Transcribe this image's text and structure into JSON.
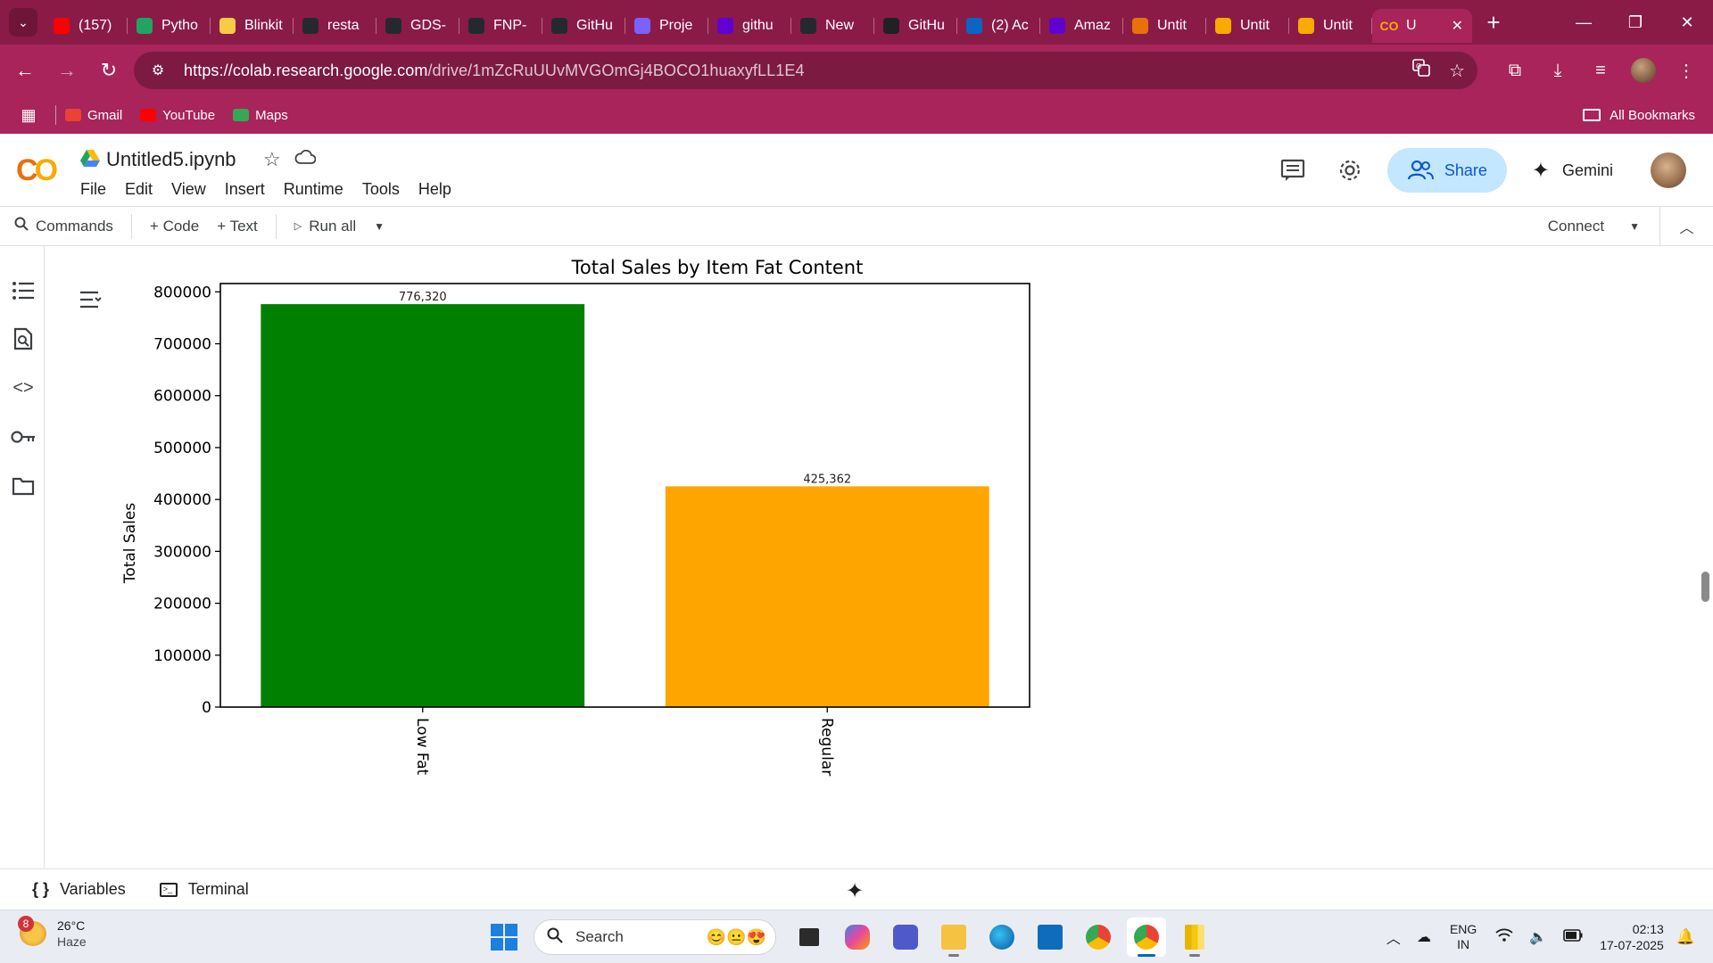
{
  "browser": {
    "tabs": [
      {
        "title": "(157)",
        "icon": "youtube-icon",
        "color": "#ff0000"
      },
      {
        "title": "Pytho",
        "icon": "google-drive-icon",
        "color": "#1fa463"
      },
      {
        "title": "Blinkit",
        "icon": "blinkit-icon",
        "color": "#f8cb46"
      },
      {
        "title": "resta",
        "icon": "github-icon",
        "color": "#24292f"
      },
      {
        "title": "GDS-",
        "icon": "github-icon",
        "color": "#24292f"
      },
      {
        "title": "FNP-",
        "icon": "github-icon",
        "color": "#24292f"
      },
      {
        "title": "GitHu",
        "icon": "github-icon",
        "color": "#24292f"
      },
      {
        "title": "Proje",
        "icon": "docs-icon",
        "color": "#7b61ff"
      },
      {
        "title": "githu",
        "icon": "yahoo-icon",
        "color": "#6001d2"
      },
      {
        "title": "New",
        "icon": "github-icon",
        "color": "#24292f"
      },
      {
        "title": "GitHu",
        "icon": "chatgpt-icon",
        "color": "#202123"
      },
      {
        "title": "(2) Ac",
        "icon": "linkedin-icon",
        "color": "#0a66c2"
      },
      {
        "title": "Amaz",
        "icon": "yahoo-icon",
        "color": "#6001d2"
      },
      {
        "title": "Untit",
        "icon": "colab-icon",
        "color": "#e8710a"
      },
      {
        "title": "Untit",
        "icon": "colab-icon",
        "color": "#f9ab00"
      },
      {
        "title": "Untit",
        "icon": "colab-icon",
        "color": "#f9ab00"
      }
    ],
    "active_tab": {
      "title": "U",
      "icon": "colab-icon"
    },
    "url_host": "https://colab.research.google.com",
    "url_path": "/drive/1mZcRuUUvMVGOmGj4BOCO1huaxyfLL1E4",
    "bookmarks": [
      {
        "label": "Gmail",
        "color": "#ea4335"
      },
      {
        "label": "YouTube",
        "color": "#ff0000"
      },
      {
        "label": "Maps",
        "color": "#34a853"
      }
    ],
    "all_bookmarks": "All Bookmarks",
    "accent": "#a8245a"
  },
  "colab": {
    "notebook_title": "Untitled5.ipynb",
    "menu": [
      "File",
      "Edit",
      "View",
      "Insert",
      "Runtime",
      "Tools",
      "Help"
    ],
    "share_label": "Share",
    "gemini_label": "Gemini",
    "toolbar": {
      "commands": "Commands",
      "code": "+ Code",
      "text": "+ Text",
      "run_all": "Run all",
      "connect": "Connect"
    },
    "status": {
      "variables": "Variables",
      "terminal": "Terminal"
    }
  },
  "chart_data": {
    "type": "bar",
    "title": "Total Sales by Item Fat Content",
    "xlabel": "",
    "ylabel": "Total Sales",
    "categories": [
      "Low Fat",
      "Regular"
    ],
    "values": [
      776320,
      425362
    ],
    "value_labels": [
      "776,320",
      "425,362"
    ],
    "colors": [
      "#008000",
      "#ffa500"
    ],
    "yticks": [
      0,
      100000,
      200000,
      300000,
      400000,
      500000,
      600000,
      700000,
      800000
    ],
    "ylim": [
      0,
      816000
    ],
    "grid": false,
    "legend": "none"
  },
  "taskbar": {
    "weather_temp": "26°C",
    "weather_cond": "Haze",
    "weather_badge": "8",
    "search_placeholder": "Search",
    "lang_top": "ENG",
    "lang_bottom": "IN",
    "time": "02:13",
    "date": "17-07-2025"
  }
}
